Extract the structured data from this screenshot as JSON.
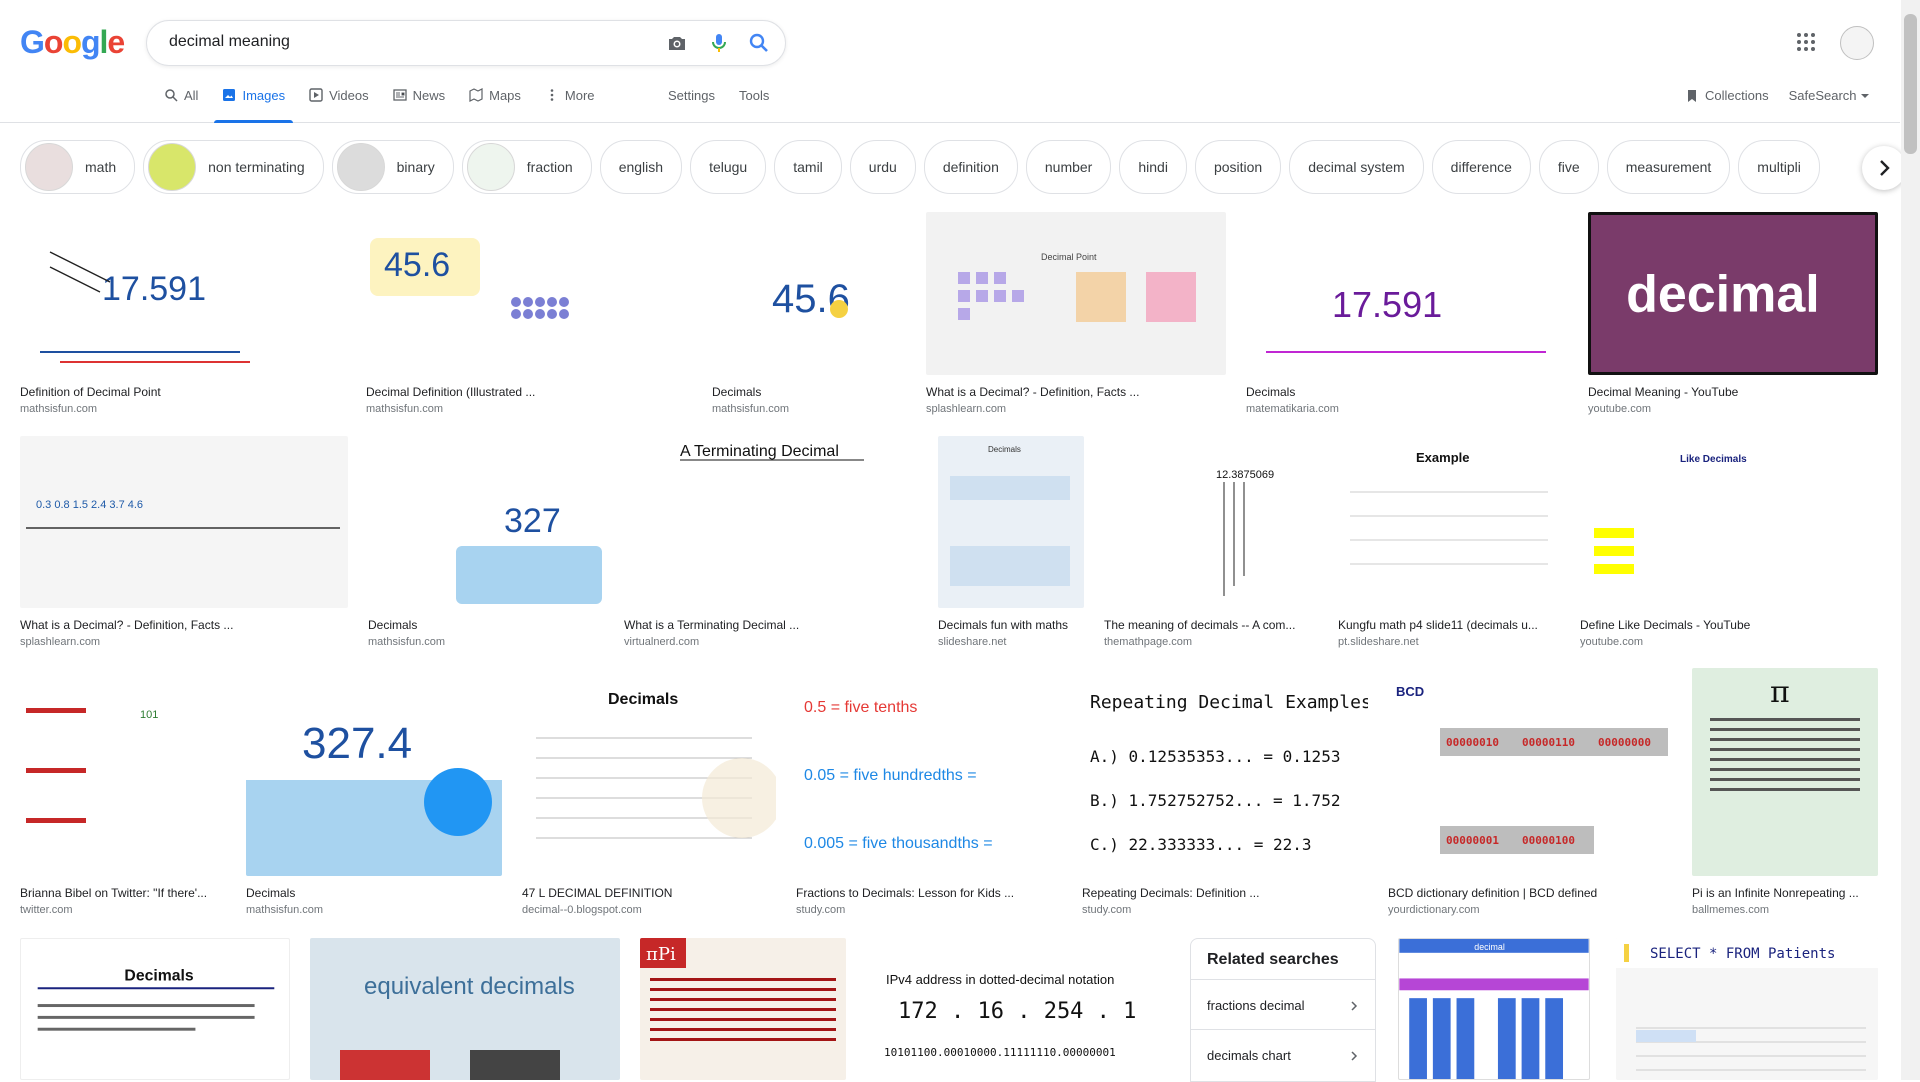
{
  "search": {
    "query": "decimal meaning"
  },
  "tabs": [
    {
      "label": "All",
      "icon": "search-icon"
    },
    {
      "label": "Images",
      "icon": "image-icon"
    },
    {
      "label": "Videos",
      "icon": "video-icon"
    },
    {
      "label": "News",
      "icon": "news-icon"
    },
    {
      "label": "Maps",
      "icon": "map-icon"
    },
    {
      "label": "More",
      "icon": "more-vert-icon"
    }
  ],
  "tools": {
    "settings": "Settings",
    "tools": "Tools"
  },
  "right": {
    "collections": "Collections",
    "safesearch": "SafeSearch"
  },
  "chips": [
    "math",
    "non terminating",
    "binary",
    "fraction",
    "english",
    "telugu",
    "tamil",
    "urdu",
    "definition",
    "number",
    "hindi",
    "position",
    "decimal system",
    "difference",
    "five",
    "measurement",
    "multipli"
  ],
  "results": [
    {
      "title": "Definition of Decimal Point",
      "source": "mathsisfun.com",
      "img_text": "17.591"
    },
    {
      "title": "Decimal Definition (Illustrated ...",
      "source": "mathsisfun.com",
      "img_text": "45.6"
    },
    {
      "title": "Decimals",
      "source": "mathsisfun.com",
      "img_text": "45.6"
    },
    {
      "title": "What is a Decimal? - Definition, Facts ...",
      "source": "splashlearn.com",
      "img_text": "Decimal Point"
    },
    {
      "title": "Decimals",
      "source": "matematikaria.com",
      "img_text": "17.591"
    },
    {
      "title": "Decimal Meaning - YouTube",
      "source": "youtube.com",
      "img_text": "decimal"
    },
    {
      "title": "What is a Decimal? - Definition, Facts ...",
      "source": "splashlearn.com",
      "img_text": "0.3 0.8 1.5 2.4 3.7 4.6"
    },
    {
      "title": "Decimals",
      "source": "mathsisfun.com",
      "img_text": "327"
    },
    {
      "title": "What is a Terminating Decimal ...",
      "source": "virtualnerd.com",
      "img_text": "A Terminating Decimal"
    },
    {
      "title": "Decimals fun with maths",
      "source": "slideshare.net",
      "img_text": "Decimals"
    },
    {
      "title": "The meaning of decimals -- A com...",
      "source": "themathpage.com",
      "img_text": "12.3875069"
    },
    {
      "title": "Kungfu math p4 slide11 (decimals u...",
      "source": "pt.slideshare.net",
      "img_text": "Example"
    },
    {
      "title": "Define Like Decimals - YouTube",
      "source": "youtube.com",
      "img_text": "Like Decimals"
    },
    {
      "title": "Brianna Bibel on Twitter: \"If there'...",
      "source": "twitter.com",
      "img_text": "101"
    },
    {
      "title": "Decimals",
      "source": "mathsisfun.com",
      "img_text": "327.4"
    },
    {
      "title": "47 L DECIMAL DEFINITION",
      "source": "decimal--0.blogspot.com",
      "img_text": "Decimals"
    },
    {
      "title": "Fractions to Decimals: Lesson for Kids ...",
      "source": "study.com",
      "img_text": "0.5 = five tenths"
    },
    {
      "title": "Repeating Decimals: Definition ...",
      "source": "study.com",
      "img_text": "Repeating Decimal Examples"
    },
    {
      "title": "BCD dictionary definition | BCD defined",
      "source": "yourdictionary.com",
      "img_text": "BCD"
    },
    {
      "title": "Pi is an Infinite Nonrepeating ...",
      "source": "ballmemes.com",
      "img_text": "π"
    },
    {
      "title": "",
      "source": "",
      "img_text": "Decimals"
    },
    {
      "title": "",
      "source": "",
      "img_text": "equivalent decimals"
    },
    {
      "title": "",
      "source": "",
      "img_text": "πPi"
    },
    {
      "title": "",
      "source": "",
      "img_text": "IPv4 address in dotted-decimal notation"
    },
    {
      "title": "",
      "source": "",
      "img_text": "decimal"
    },
    {
      "title": "",
      "source": "",
      "img_text": "SELECT * FROM Patients"
    }
  ],
  "related": {
    "heading": "Related searches",
    "items": [
      "fractions decimal",
      "decimals chart"
    ]
  }
}
